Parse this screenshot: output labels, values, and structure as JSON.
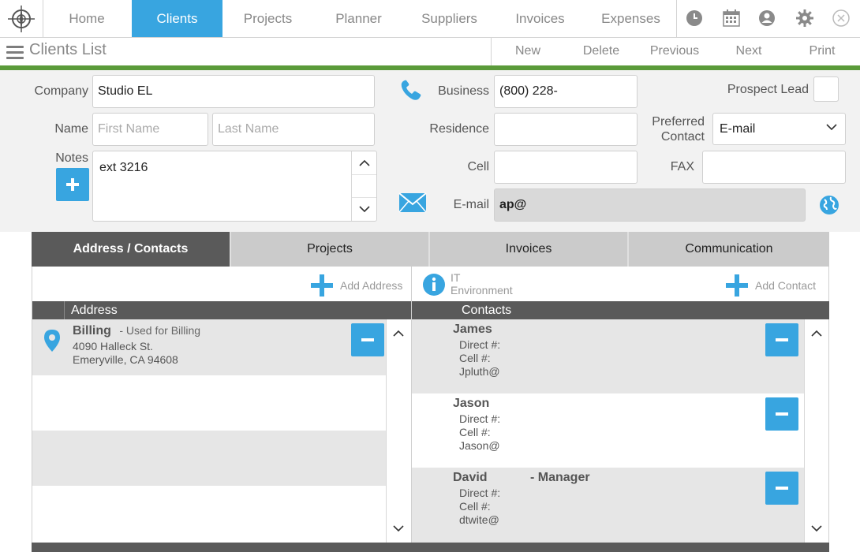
{
  "nav": {
    "tabs": [
      "Home",
      "Clients",
      "Projects",
      "Planner",
      "Suppliers",
      "Invoices",
      "Expenses"
    ],
    "active": "Clients",
    "icons": [
      "clock-icon",
      "calendar-icon",
      "user-icon",
      "gear-icon",
      "close-icon"
    ]
  },
  "subheader": {
    "title": "Clients List",
    "actions": [
      "New",
      "Delete",
      "Previous",
      "Next",
      "Print"
    ]
  },
  "form": {
    "company_label": "Company",
    "company_value": "Studio EL",
    "name_label": "Name",
    "first_name_placeholder": "First Name",
    "last_name_placeholder": "Last Name",
    "notes_label": "Notes",
    "notes_value": "ext 3216",
    "business_label": "Business",
    "business_value": "(800) 228-",
    "residence_label": "Residence",
    "residence_value": "",
    "cell_label": "Cell",
    "cell_value": "",
    "email_label": "E-mail",
    "email_value": "ap@",
    "prospect_label": "Prospect Lead",
    "preferred_label_1": "Preferred",
    "preferred_label_2": "Contact",
    "preferred_value": "E-mail",
    "fax_label": "FAX",
    "fax_value": ""
  },
  "tabs": [
    "Address / Contacts",
    "Projects",
    "Invoices",
    "Communication"
  ],
  "active_tab": "Address / Contacts",
  "address_panel": {
    "add_label": "Add Address",
    "header": "Address",
    "items": [
      {
        "title": "Billing",
        "subtitle": "- Used for Billing",
        "line1": "4090 Halleck St.",
        "line2": "Emeryville, CA  94608"
      }
    ]
  },
  "contacts_panel": {
    "it_label_1": "IT",
    "it_label_2": "Environment",
    "add_label": "Add Contact",
    "header": "Contacts",
    "items": [
      {
        "name": "James",
        "role": "",
        "direct": "Direct #:",
        "cell": "Cell #:",
        "email": "Jpluth@"
      },
      {
        "name": "Jason",
        "role": "",
        "direct": "Direct #:",
        "cell": "Cell #:",
        "email": "Jason@"
      },
      {
        "name": "David",
        "role": "- Manager",
        "direct": "Direct #:",
        "cell": "Cell #:",
        "email": "dtwite@"
      }
    ]
  },
  "colors": {
    "accent": "#38a5e0",
    "green": "#5b9b3a",
    "dark": "#5a5a5a"
  }
}
